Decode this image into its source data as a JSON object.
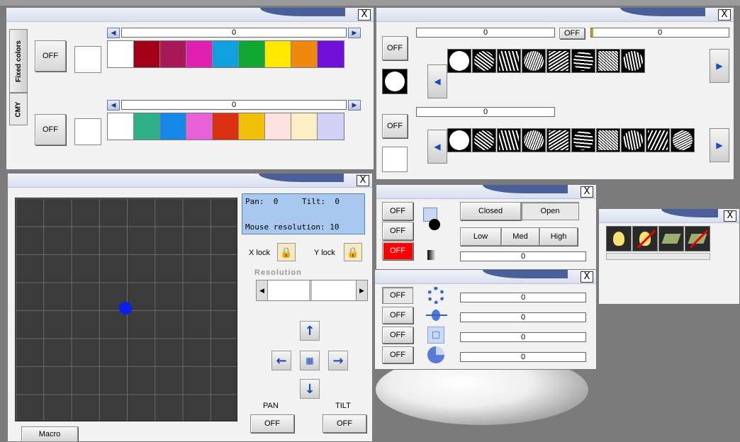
{
  "close_glyph": "X",
  "color_window": {
    "tabs": [
      "Fixed colors",
      "CMY"
    ],
    "rows": [
      {
        "off_label": "OFF",
        "value": "0",
        "left_arrow": "◀",
        "right_arrow": "▶",
        "swatches": [
          "#ffffff",
          "#a00018",
          "#a81858",
          "#e020b0",
          "#10a0e0",
          "#10a830",
          "#ffe800",
          "#f08810",
          "#7010d8"
        ]
      },
      {
        "off_label": "OFF",
        "value": "0",
        "left_arrow": "◀",
        "right_arrow": "▶",
        "swatches": [
          "#ffffff",
          "#30b088",
          "#1888e8",
          "#e860d8",
          "#d83010",
          "#f0c008",
          "#fde0e0",
          "#fcefc8",
          "#d0d0f8"
        ]
      }
    ]
  },
  "gobo_window": {
    "top_bar_value": "0",
    "off2_label": "OFF",
    "right_bar_value": "0",
    "row1": {
      "off_label": "OFF",
      "left_arrow": "◀",
      "right_arrow": "▶",
      "gobo_count": 8
    },
    "mid_bar_value": "0",
    "row2": {
      "off_label": "OFF",
      "left_arrow": "◀",
      "right_arrow": "▶",
      "gobo_count": 10
    }
  },
  "pantilt_window": {
    "pan_label": "Pan:",
    "pan_value": "0",
    "tilt_label": "Tilt:",
    "tilt_value": "0",
    "mouse_res_label": "Mouse resolution:",
    "mouse_res_value": "10",
    "xlock_label": "X lock",
    "ylock_label": "Y lock",
    "resolution_label": "Resolution",
    "pan_caption": "PAN",
    "tilt_caption": "TILT",
    "pan_off": "OFF",
    "tilt_off": "OFF",
    "macro_label": "Macro",
    "arrows": {
      "up": "↑",
      "down": "↓",
      "left": "←",
      "right": "→"
    }
  },
  "shutter_window": {
    "off_buttons": [
      "OFF",
      "OFF",
      "OFF"
    ],
    "closed_label": "Closed",
    "open_label": "Open",
    "low_label": "Low",
    "med_label": "Med",
    "high_label": "High",
    "value": "0"
  },
  "effects_window": {
    "rows": [
      {
        "off_label": "OFF",
        "value": "0"
      },
      {
        "off_label": "OFF",
        "value": "0"
      },
      {
        "off_label": "OFF",
        "value": "0"
      },
      {
        "off_label": "OFF",
        "value": "0"
      }
    ]
  },
  "lamp_window": {
    "icons": [
      "lamp-on-icon",
      "lamp-off-icon",
      "lamp-reset-icon",
      "lamp-reset-off-icon"
    ]
  }
}
